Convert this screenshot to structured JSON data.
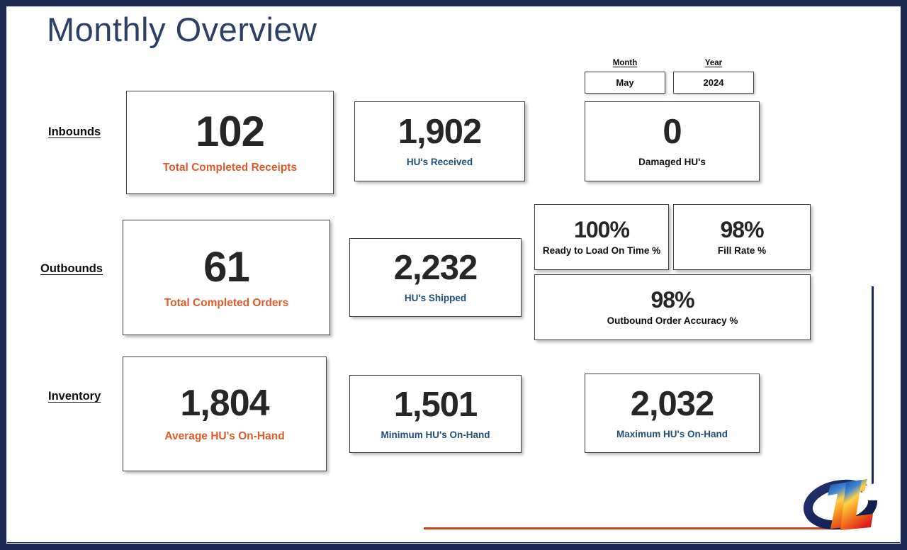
{
  "slide": {
    "title": "Monthly Overview",
    "frame_color": "#1b2a55",
    "accent_line_color": "#c0441a",
    "background": "#ffffff"
  },
  "filters": {
    "month": {
      "label": "Month",
      "value": "May"
    },
    "year": {
      "label": "Year",
      "value": "2024"
    }
  },
  "rows": {
    "inbounds": {
      "label": "Inbounds"
    },
    "outbounds": {
      "label": "Outbounds"
    },
    "inventory": {
      "label": "Inventory"
    }
  },
  "cards": {
    "total_completed_receipts": {
      "value": "102",
      "label": "Total Completed Receipts",
      "value_color": "#262626",
      "label_color": "#e05a2b"
    },
    "hus_received": {
      "value": "1,902",
      "label": "HU's Received",
      "value_color": "#262626",
      "label_color": "#1f4e79"
    },
    "damaged_hus": {
      "value": "0",
      "label": "Damaged HU's",
      "value_color": "#1aa01a",
      "label_color": "#0d0d0d"
    },
    "total_completed_orders": {
      "value": "61",
      "label": "Total Completed Orders",
      "value_color": "#262626",
      "label_color": "#e05a2b"
    },
    "hus_shipped": {
      "value": "2,232",
      "label": "HU's Shipped",
      "value_color": "#262626",
      "label_color": "#1f4e79"
    },
    "ready_to_load_on_time": {
      "value": "100%",
      "label": "Ready to Load On Time %",
      "value_color": "#1aa01a",
      "label_color": "#0d0d0d"
    },
    "fill_rate": {
      "value": "98%",
      "label": "Fill Rate %",
      "value_color": "#f2b40e",
      "label_color": "#0d0d0d"
    },
    "outbound_order_accuracy": {
      "value": "98%",
      "label": "Outbound Order Accuracy %",
      "value_color": "#f2b40e",
      "label_color": "#0d0d0d"
    },
    "average_hus_on_hand": {
      "value": "1,804",
      "label": "Average HU's On-Hand",
      "value_color": "#262626",
      "label_color": "#e05a2b"
    },
    "minimum_hus_on_hand": {
      "value": "1,501",
      "label": "Minimum HU's On-Hand",
      "value_color": "#262626",
      "label_color": "#1f4e79"
    },
    "maximum_hus_on_hand": {
      "value": "2,032",
      "label": "Maximum HU's On-Hand",
      "value_color": "#262626",
      "label_color": "#1f4e79"
    }
  },
  "logo": {
    "name": "ctl-logo",
    "text": "CTL"
  }
}
